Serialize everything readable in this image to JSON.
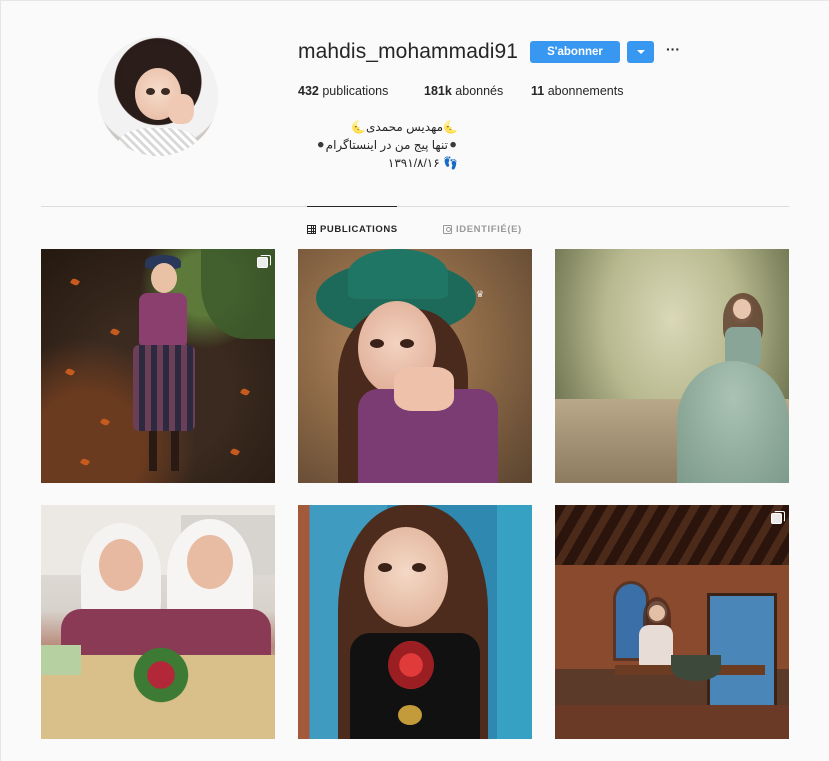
{
  "profile": {
    "username": "mahdis_mohammadi91",
    "follow_label": "S'abonner",
    "more_icon": "···",
    "stats": {
      "posts_count": "432",
      "posts_label": "publications",
      "followers_count": "181k",
      "followers_label": "abonnés",
      "following_count": "11",
      "following_label": "abonnements"
    },
    "bio": {
      "name_line": "مهدیس محمدی",
      "moon_emoji": "🌜",
      "line2": "تنها پیج من در اینستاگرام",
      "dot_emoji": "⚫",
      "line3": "۱۳۹۱/۸/۱۶",
      "feet_emoji": "👣"
    }
  },
  "tabs": [
    {
      "label": "PUBLICATIONS",
      "icon": "grid-icon",
      "active": true
    },
    {
      "label": "IDENTIFIÉ(E)",
      "icon": "tag-icon",
      "active": false
    }
  ],
  "colors": {
    "accent": "#3897f0",
    "background": "#fafafa",
    "text": "#262626",
    "muted": "#999999"
  },
  "posts": [
    {
      "icon": "carousel-icon",
      "multi": true
    },
    {
      "multi": false
    },
    {
      "multi": false
    },
    {
      "multi": false
    },
    {
      "multi": false
    },
    {
      "icon": "carousel-icon",
      "multi": true
    }
  ]
}
